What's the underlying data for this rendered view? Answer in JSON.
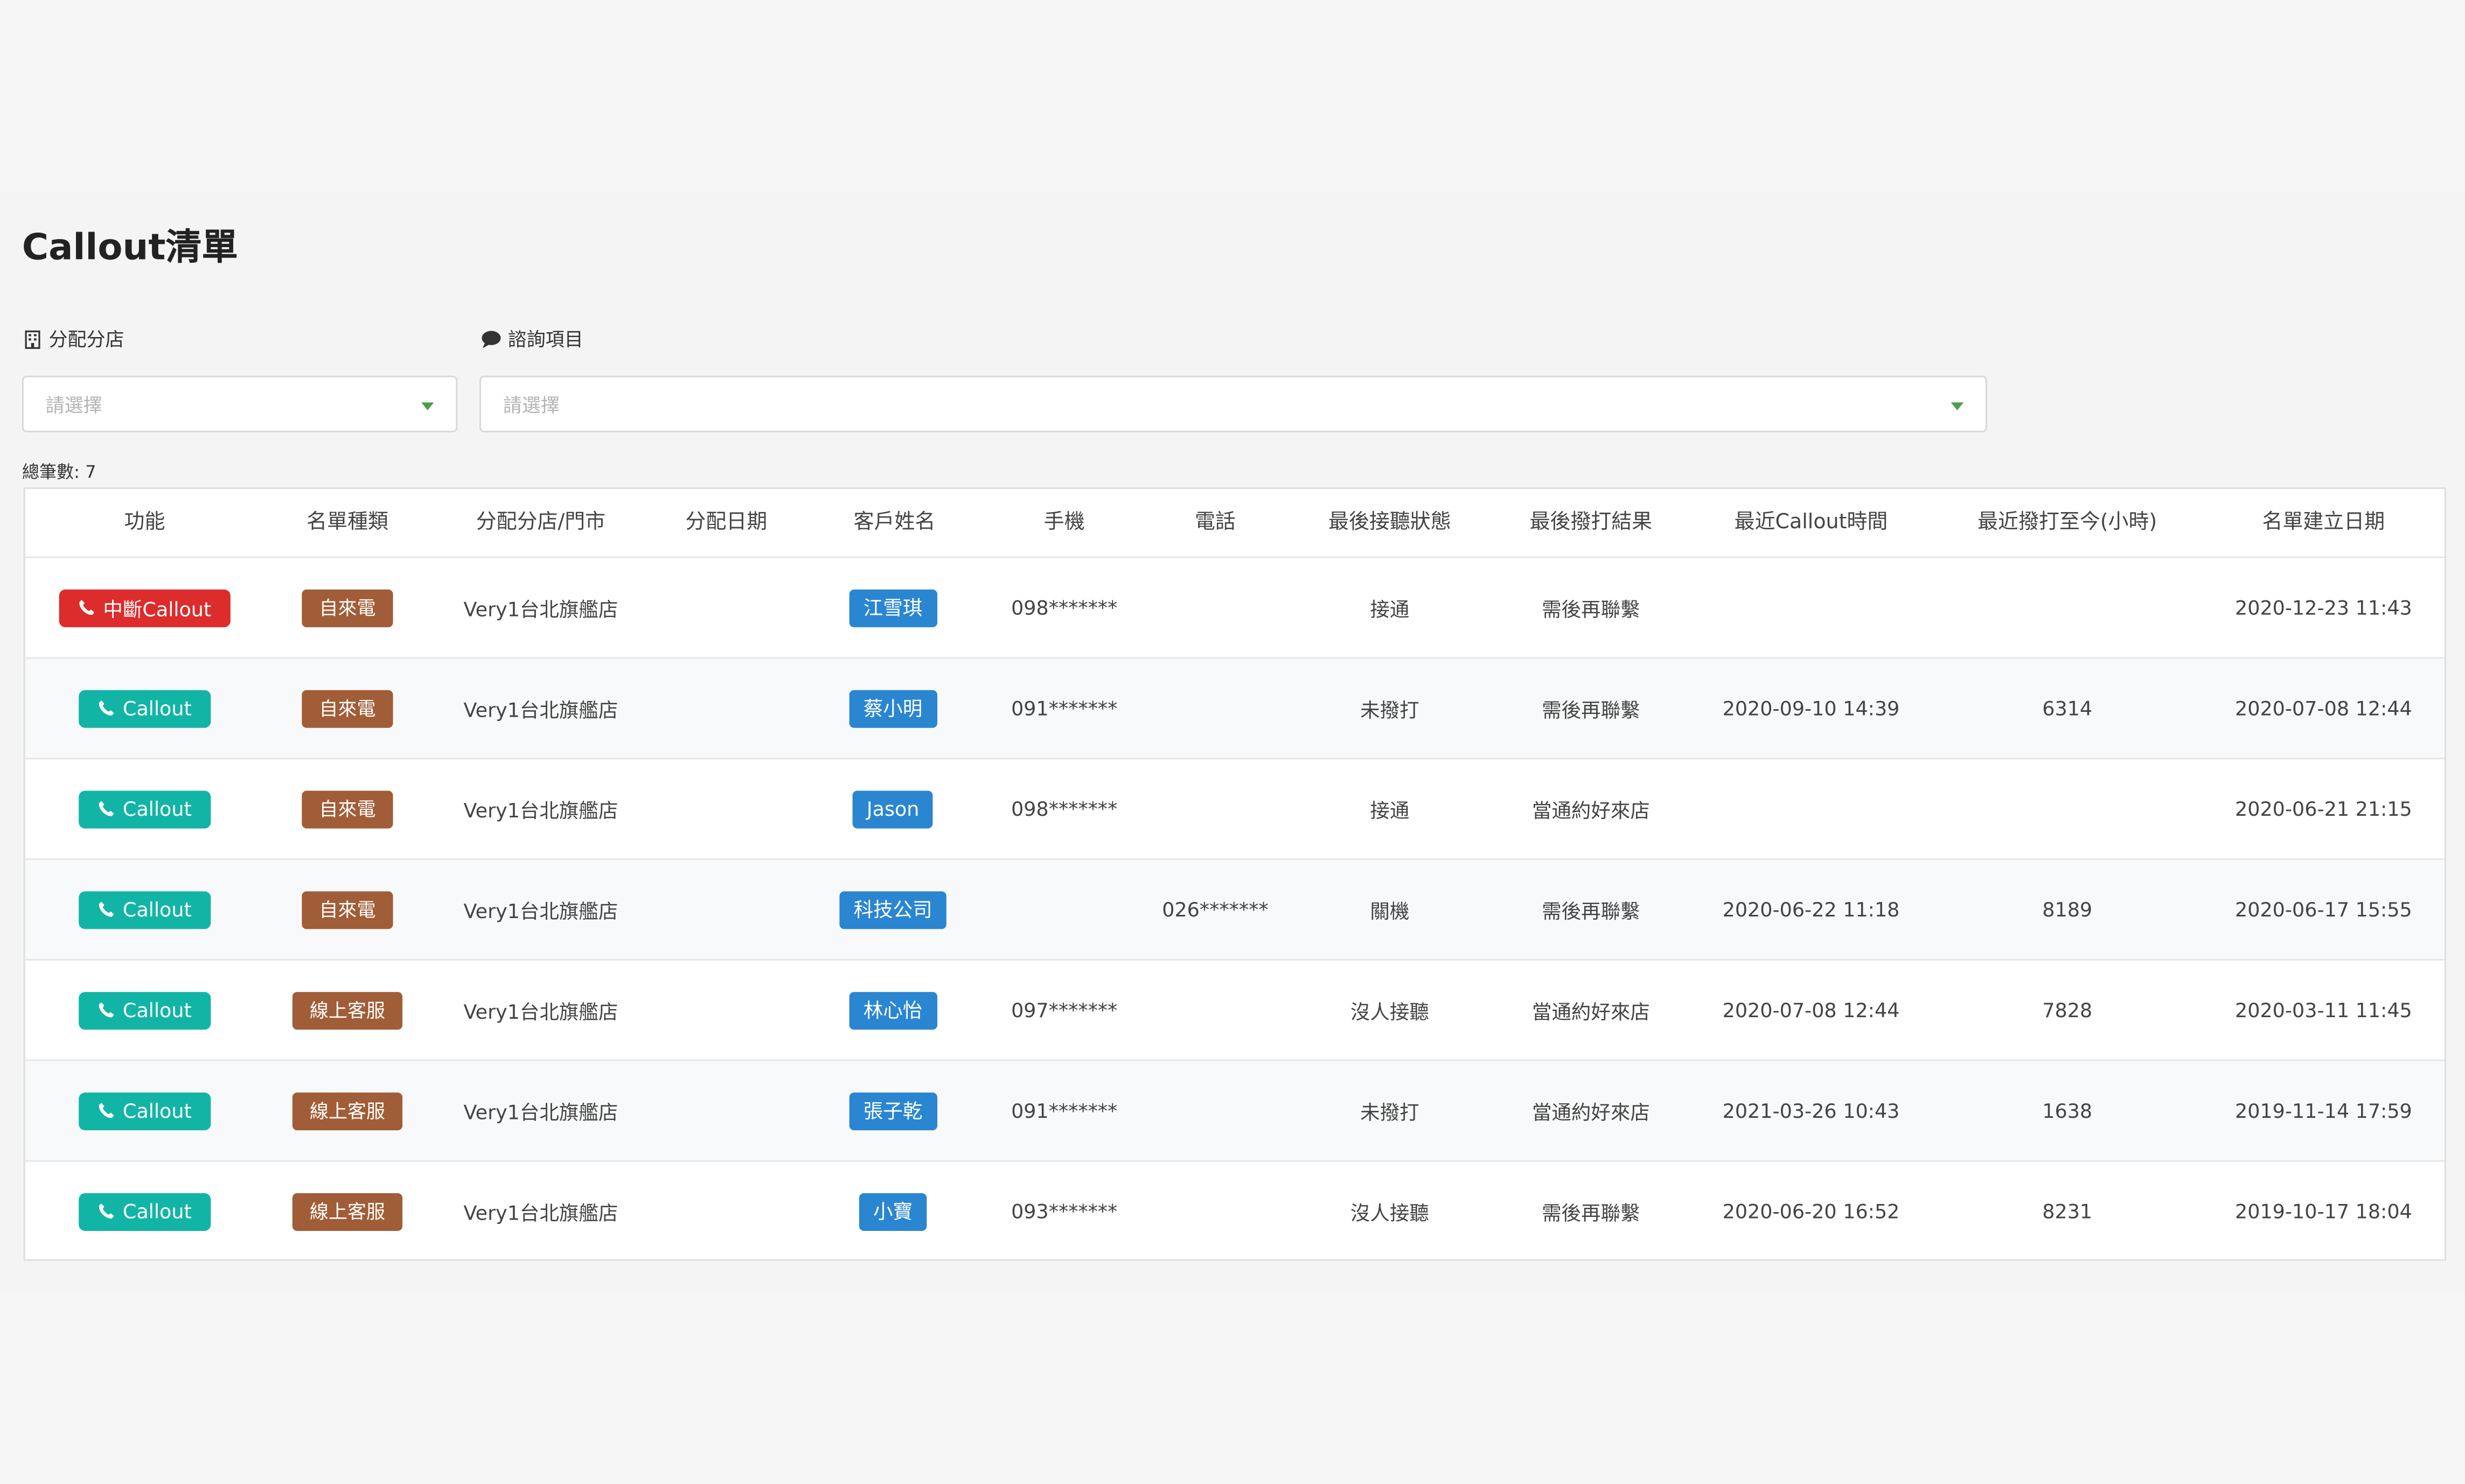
{
  "page": {
    "title": "Callout清單",
    "total_label": "總筆數: 7"
  },
  "filters": {
    "store": {
      "label": "分配分店",
      "icon": "building-icon",
      "placeholder": "請選擇"
    },
    "consult": {
      "label": "諮詢項目",
      "icon": "comment-icon",
      "placeholder": "請選擇"
    }
  },
  "colors": {
    "callout_button": "#12b5a5",
    "interrupt_button": "#dc2c2c",
    "list_type_badge": "#a15d37",
    "customer_badge": "#2a86d1",
    "select_caret": "#4aa04a"
  },
  "table": {
    "headers": [
      "功能",
      "名單種類",
      "分配分店/門市",
      "分配日期",
      "客戶姓名",
      "手機",
      "電話",
      "最後接聽狀態",
      "最後撥打結果",
      "最近Callout時間",
      "最近撥打至今(小時)",
      "名單建立日期"
    ],
    "rows": [
      {
        "action": "中斷Callout",
        "action_style": "red",
        "list_type": "自來電",
        "store": "Very1台北旗艦店",
        "assign_date": "",
        "customer": "江雪琪",
        "mobile": "098*******",
        "phone": "",
        "answer_status": "接通",
        "call_result": "需後再聯繫",
        "last_callout": "",
        "hours_since": "",
        "created": "2020-12-23 11:43"
      },
      {
        "action": "Callout",
        "action_style": "teal",
        "list_type": "自來電",
        "store": "Very1台北旗艦店",
        "assign_date": "",
        "customer": "蔡小明",
        "mobile": "091*******",
        "phone": "",
        "answer_status": "未撥打",
        "call_result": "需後再聯繫",
        "last_callout": "2020-09-10 14:39",
        "hours_since": "6314",
        "created": "2020-07-08 12:44"
      },
      {
        "action": "Callout",
        "action_style": "teal",
        "list_type": "自來電",
        "store": "Very1台北旗艦店",
        "assign_date": "",
        "customer": "Jason",
        "mobile": "098*******",
        "phone": "",
        "answer_status": "接通",
        "call_result": "當通約好來店",
        "last_callout": "",
        "hours_since": "",
        "created": "2020-06-21 21:15"
      },
      {
        "action": "Callout",
        "action_style": "teal",
        "list_type": "自來電",
        "store": "Very1台北旗艦店",
        "assign_date": "",
        "customer": "科技公司",
        "mobile": "",
        "phone": "026*******",
        "answer_status": "關機",
        "call_result": "需後再聯繫",
        "last_callout": "2020-06-22 11:18",
        "hours_since": "8189",
        "created": "2020-06-17 15:55"
      },
      {
        "action": "Callout",
        "action_style": "teal",
        "list_type": "線上客服",
        "store": "Very1台北旗艦店",
        "assign_date": "",
        "customer": "林心怡",
        "mobile": "097*******",
        "phone": "",
        "answer_status": "沒人接聽",
        "call_result": "當通約好來店",
        "last_callout": "2020-07-08 12:44",
        "hours_since": "7828",
        "created": "2020-03-11 11:45"
      },
      {
        "action": "Callout",
        "action_style": "teal",
        "list_type": "線上客服",
        "store": "Very1台北旗艦店",
        "assign_date": "",
        "customer": "張子乾",
        "mobile": "091*******",
        "phone": "",
        "answer_status": "未撥打",
        "call_result": "當通約好來店",
        "last_callout": "2021-03-26 10:43",
        "hours_since": "1638",
        "created": "2019-11-14 17:59"
      },
      {
        "action": "Callout",
        "action_style": "teal",
        "list_type": "線上客服",
        "store": "Very1台北旗艦店",
        "assign_date": "",
        "customer": "小寶",
        "mobile": "093*******",
        "phone": "",
        "answer_status": "沒人接聽",
        "call_result": "需後再聯繫",
        "last_callout": "2020-06-20 16:52",
        "hours_since": "8231",
        "created": "2019-10-17 18:04"
      }
    ]
  }
}
